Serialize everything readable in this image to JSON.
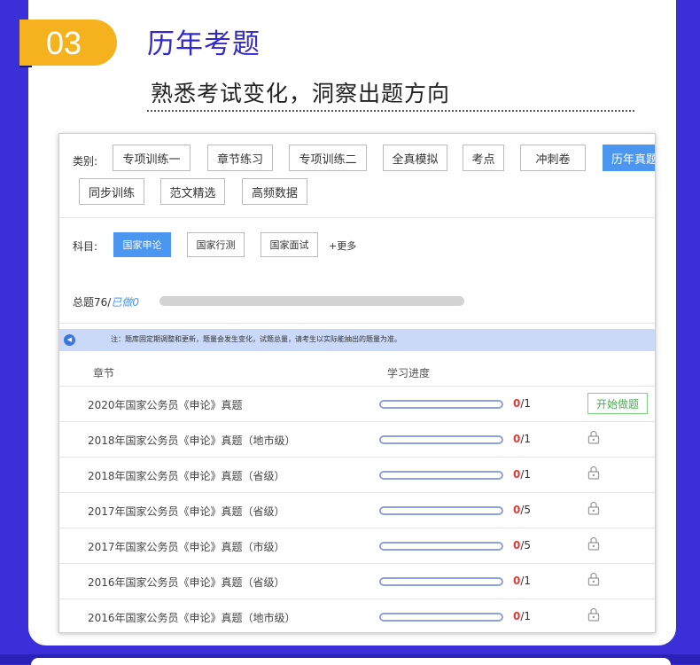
{
  "section": {
    "number": "03",
    "title": "历年考题",
    "subtitle": "熟悉考试变化，洞察出题方向"
  },
  "screenshot": {
    "category_label": "类别:",
    "categories": [
      {
        "label": "专项训练一",
        "active": false
      },
      {
        "label": "章节练习",
        "active": false
      },
      {
        "label": "专项训练二",
        "active": false
      },
      {
        "label": "全真模拟",
        "active": false
      },
      {
        "label": "考点",
        "active": false
      },
      {
        "label": "冲刺卷",
        "active": false
      },
      {
        "label": "历年真题",
        "active": true
      },
      {
        "label": "同步训练",
        "active": false
      },
      {
        "label": "范文精选",
        "active": false
      },
      {
        "label": "高频数据",
        "active": false
      }
    ],
    "subject_label": "科目:",
    "subjects": [
      {
        "label": "国家申论",
        "active": true
      },
      {
        "label": "国家行测",
        "active": false
      },
      {
        "label": "国家面试",
        "active": false
      }
    ],
    "more_label": "+更多",
    "total_label": "总题76/",
    "done_label": "已做0",
    "notice": "注：题库固定期调整和更新，题量会发生变化，试题总量，请考生以实际能抽出的题量为准。",
    "table_headers": {
      "chapter": "章节",
      "progress": "学习进度"
    },
    "start_label": "开始做题",
    "rows": [
      {
        "name": "2020年国家公务员《申论》真题",
        "done": "0",
        "total": "/1",
        "locked": false,
        "progress": 0
      },
      {
        "name": "2018年国家公务员《申论》真题（地市级）",
        "done": "0",
        "total": "/1",
        "locked": true,
        "progress": 0
      },
      {
        "name": "2018年国家公务员《申论》真题（省级）",
        "done": "0",
        "total": "/1",
        "locked": true,
        "progress": 0
      },
      {
        "name": "2017年国家公务员《申论》真题（省级）",
        "done": "0",
        "total": "/5",
        "locked": true,
        "progress": 0
      },
      {
        "name": "2017年国家公务员《申论》真题（市级）",
        "done": "0",
        "total": "/5",
        "locked": true,
        "progress": 0
      },
      {
        "name": "2016年国家公务员《申论》真题（省级）",
        "done": "0",
        "total": "/1",
        "locked": true,
        "progress": 0
      },
      {
        "name": "2016年国家公务员《申论》真题（地市级）",
        "done": "0",
        "total": "/1",
        "locked": true,
        "progress": 0
      }
    ]
  },
  "colors": {
    "background": "#3a2fd8",
    "badge": "#f4b21e",
    "title": "#3328c8",
    "active": "#4a96f0",
    "progress_done": "#e53935"
  },
  "icons": {
    "speaker": "speaker-icon",
    "lock": "lock-icon"
  }
}
